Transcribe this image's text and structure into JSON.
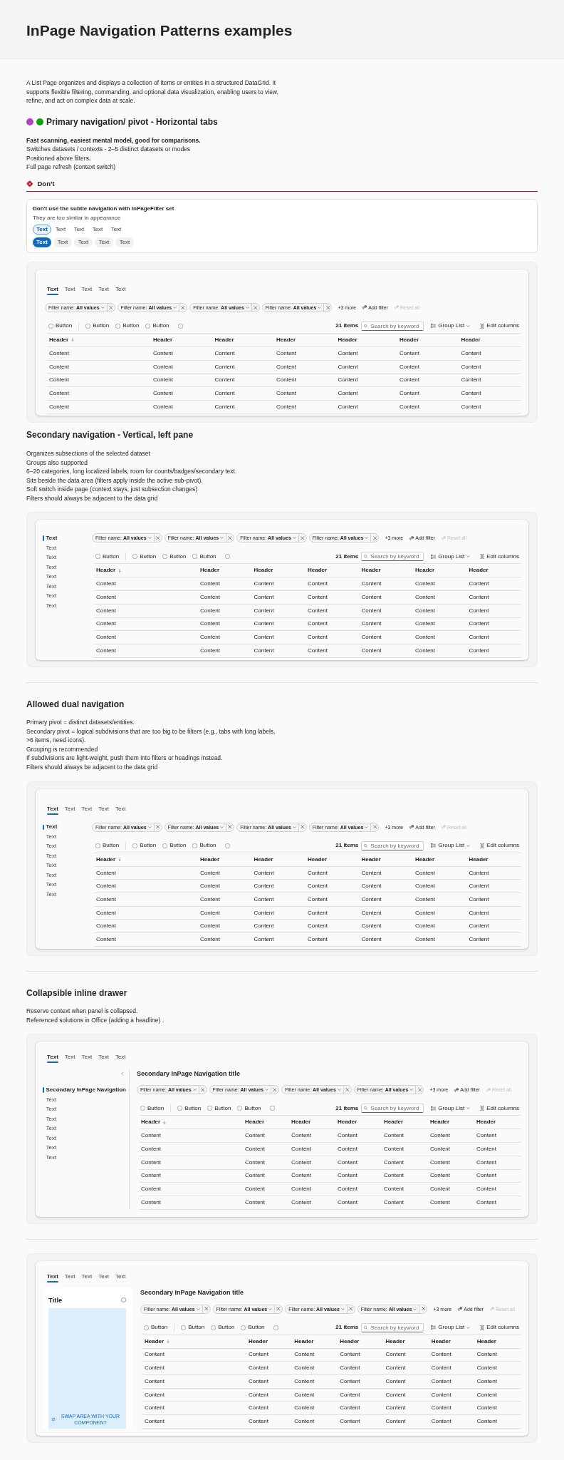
{
  "page_header": {
    "title": "InPage Navigation Patterns examples"
  },
  "intro": "A List Page organizes and displays a collection of items or entities in a structured DataGrid. It supports flexible filtering, commanding, and optional data visualization, enabling users to view, refine, and act on complex data at scale.",
  "sections": [
    {
      "divider_above": false,
      "title": "Primary navigation/ pivot - Horizontal tabs",
      "markers": [
        {
          "color": "#b146c2"
        },
        {
          "color": "#13a10e"
        }
      ],
      "notes": [
        {
          "text": "Fast scanning, easiest mental model, good for comparisons.",
          "bold": true
        },
        {
          "text": "Switches datasets / contexts - 2–5 distinct datasets or modes",
          "bold": false
        },
        {
          "text": "Positioned above filters**.**",
          "bold": false
        },
        {
          "text": "Full page refresh (context switch)",
          "bold": false
        }
      ],
      "guideline": {
        "kind": "dont",
        "label": "Don’t",
        "title": "Don't use the subtle navigation with InPageFilter set",
        "description": "They are too similar in appearance",
        "subtle_tabs": [
          {
            "label": "Text",
            "selected": true
          },
          {
            "label": "Text",
            "selected": false
          },
          {
            "label": "Text",
            "selected": false
          },
          {
            "label": "Text",
            "selected": false
          },
          {
            "label": "Text",
            "selected": false
          }
        ],
        "pill_tabs": [
          {
            "label": "Text",
            "selected": true
          },
          {
            "label": "Text",
            "selected": false
          },
          {
            "label": "Text",
            "selected": false
          },
          {
            "label": "Text",
            "selected": false
          },
          {
            "label": "Text",
            "selected": false
          }
        ]
      },
      "example": {
        "tabs": [
          {
            "label": "Text",
            "selected": true
          },
          {
            "label": "Text",
            "selected": false
          },
          {
            "label": "Text",
            "selected": false
          },
          {
            "label": "Text",
            "selected": false
          },
          {
            "label": "Text",
            "selected": false
          }
        ],
        "filters": [
          {
            "name": "Filter name:",
            "value": "All values"
          },
          {
            "name": "Filter name:",
            "value": "All values"
          },
          {
            "name": "Filter name:",
            "value": "All values"
          },
          {
            "name": "Filter name:",
            "value": "All values"
          }
        ],
        "more_filters": "+3 more",
        "add_filter": "Add filter",
        "reset": {
          "label": "Reset all",
          "disabled": true
        },
        "actions": [
          {
            "kind": "radio",
            "label": "Button",
            "checked": false
          },
          {
            "kind": "radio",
            "label": "Button",
            "checked": false
          },
          {
            "kind": "radio",
            "label": "Button",
            "checked": false
          },
          {
            "kind": "radio",
            "label": "Button",
            "checked": false
          },
          {
            "kind": "radio_icon",
            "checked": false
          }
        ],
        "item_count": "21 items",
        "search": {
          "placeholder": "Search by keyword"
        },
        "group_by": "Group List",
        "edit_columns": "Edit columns",
        "table": {
          "columns": [
            {
              "label": "Header",
              "sorted": true
            },
            {
              "label": "Header",
              "sorted": false
            },
            {
              "label": "Header",
              "sorted": false
            },
            {
              "label": "Header",
              "sorted": false
            },
            {
              "label": "Header",
              "sorted": false
            },
            {
              "label": "Header",
              "sorted": false
            },
            {
              "label": "Header",
              "sorted": false
            }
          ],
          "rows": [
            [
              "Content",
              "Content",
              "Content",
              "Content",
              "Content",
              "Content",
              "Content"
            ],
            [
              "Content",
              "Content",
              "Content",
              "Content",
              "Content",
              "Content",
              "Content"
            ],
            [
              "Content",
              "Content",
              "Content",
              "Content",
              "Content",
              "Content",
              "Content"
            ],
            [
              "Content",
              "Content",
              "Content",
              "Content",
              "Content",
              "Content",
              "Content"
            ],
            [
              "Content",
              "Content",
              "Content",
              "Content",
              "Content",
              "Content",
              "Content"
            ]
          ]
        }
      }
    },
    {
      "divider_above": false,
      "title": "Secondary navigation - Vertical, left pane",
      "notes": [
        {
          "text": "Organizes subsections of the selected dataset",
          "bold": false
        },
        {
          "text": "Groups also supported",
          "bold": false
        },
        {
          "text": "6–20 categories, long localized labels, room for counts/badges/secondary text.",
          "bold": false
        },
        {
          "text": "Sits beside the data area (filters apply inside the active sub-pivot).",
          "bold": false
        },
        {
          "text": "Soft switch inside page (context stays, just subsection changes)",
          "bold": false
        },
        {
          "text": "Filters should always be adjacent to the data grid",
          "bold": false
        }
      ],
      "example": {
        "side_nav": {
          "collapsible": false,
          "items": [
            {
              "label": "Text",
              "selected": true
            },
            {
              "label": "Text",
              "selected": false
            },
            {
              "label": "Text",
              "selected": false
            },
            {
              "label": "Text",
              "selected": false
            },
            {
              "label": "Text",
              "selected": false
            },
            {
              "label": "Text",
              "selected": false
            },
            {
              "label": "Text",
              "selected": false
            },
            {
              "label": "Text",
              "selected": false
            }
          ]
        },
        "filters": [
          {
            "name": "Filter name:",
            "value": "All values"
          },
          {
            "name": "Filter name:",
            "value": "All values"
          },
          {
            "name": "Filter name:",
            "value": "All values"
          },
          {
            "name": "Filter name:",
            "value": "All values"
          }
        ],
        "more_filters": "+3 more",
        "add_filter": "Add filter",
        "reset": {
          "label": "Reset all",
          "disabled": true
        },
        "actions": [
          {
            "kind": "radio",
            "label": "Button",
            "checked": false
          },
          {
            "kind": "radio",
            "label": "Button",
            "checked": false
          },
          {
            "kind": "radio",
            "label": "Button",
            "checked": false
          },
          {
            "kind": "radio",
            "label": "Button",
            "checked": false
          },
          {
            "kind": "radio_icon",
            "checked": false
          }
        ],
        "item_count": "21 items",
        "search": {
          "placeholder": "Search by keyword"
        },
        "group_by": "Group List",
        "edit_columns": "Edit columns",
        "table": {
          "columns": [
            {
              "label": "Header",
              "sorted": true
            },
            {
              "label": "Header",
              "sorted": false
            },
            {
              "label": "Header",
              "sorted": false
            },
            {
              "label": "Header",
              "sorted": false
            },
            {
              "label": "Header",
              "sorted": false
            },
            {
              "label": "Header",
              "sorted": false
            },
            {
              "label": "Header",
              "sorted": false
            }
          ],
          "rows": [
            [
              "Content",
              "Content",
              "Content",
              "Content",
              "Content",
              "Content",
              "Content"
            ],
            [
              "Content",
              "Content",
              "Content",
              "Content",
              "Content",
              "Content",
              "Content"
            ],
            [
              "Content",
              "Content",
              "Content",
              "Content",
              "Content",
              "Content",
              "Content"
            ],
            [
              "Content",
              "Content",
              "Content",
              "Content",
              "Content",
              "Content",
              "Content"
            ],
            [
              "Content",
              "Content",
              "Content",
              "Content",
              "Content",
              "Content",
              "Content"
            ],
            [
              "Content",
              "Content",
              "Content",
              "Content",
              "Content",
              "Content",
              "Content"
            ]
          ]
        }
      }
    },
    {
      "divider_above": true,
      "title": "Allowed dual navigation",
      "notes": [
        {
          "text": "Primary pivot = distinct datasets/entities.",
          "bold": false
        },
        {
          "text": "Secondary pivot = logical subdivisions that are too big to be filters (e.g., tabs with long labels, >6 items, need icons).",
          "bold": false
        },
        {
          "text": "Grouping is recommended",
          "bold": false
        },
        {
          "text": "If subdivisions are light-weight, push them into filters or headings instead.",
          "bold": false
        },
        {
          "text": "Filters should always be adjacent to the data grid",
          "bold": false
        }
      ],
      "example": {
        "tabs": [
          {
            "label": "Text",
            "selected": true
          },
          {
            "label": "Text",
            "selected": false
          },
          {
            "label": "Text",
            "selected": false
          },
          {
            "label": "Text",
            "selected": false
          },
          {
            "label": "Text",
            "selected": false
          }
        ],
        "side_nav": {
          "collapsible": false,
          "items": [
            {
              "label": "Text",
              "selected": true
            },
            {
              "label": "Text",
              "selected": false
            },
            {
              "label": "Text",
              "selected": false
            },
            {
              "label": "Text",
              "selected": false
            },
            {
              "label": "Text",
              "selected": false
            },
            {
              "label": "Text",
              "selected": false
            },
            {
              "label": "Text",
              "selected": false
            },
            {
              "label": "Text",
              "selected": false
            }
          ]
        },
        "filters": [
          {
            "name": "Filter name:",
            "value": "All values"
          },
          {
            "name": "Filter name:",
            "value": "All values"
          },
          {
            "name": "Filter name:",
            "value": "All values"
          },
          {
            "name": "Filter name:",
            "value": "All values"
          }
        ],
        "more_filters": "+3 more",
        "add_filter": "Add filter",
        "reset": {
          "label": "Reset all",
          "disabled": true
        },
        "actions": [
          {
            "kind": "radio",
            "label": "Button",
            "checked": false
          },
          {
            "kind": "radio",
            "label": "Button",
            "checked": false
          },
          {
            "kind": "radio",
            "label": "Button",
            "checked": false
          },
          {
            "kind": "radio",
            "label": "Button",
            "checked": false
          },
          {
            "kind": "radio_icon",
            "checked": false
          }
        ],
        "item_count": "21 items",
        "search": {
          "placeholder": "Search by keyword"
        },
        "group_by": "Group List",
        "edit_columns": "Edit columns",
        "table": {
          "columns": [
            {
              "label": "Header",
              "sorted": true
            },
            {
              "label": "Header",
              "sorted": false
            },
            {
              "label": "Header",
              "sorted": false
            },
            {
              "label": "Header",
              "sorted": false
            },
            {
              "label": "Header",
              "sorted": false
            },
            {
              "label": "Header",
              "sorted": false
            },
            {
              "label": "Header",
              "sorted": false
            }
          ],
          "rows": [
            [
              "Content",
              "Content",
              "Content",
              "Content",
              "Content",
              "Content",
              "Content"
            ],
            [
              "Content",
              "Content",
              "Content",
              "Content",
              "Content",
              "Content",
              "Content"
            ],
            [
              "Content",
              "Content",
              "Content",
              "Content",
              "Content",
              "Content",
              "Content"
            ],
            [
              "Content",
              "Content",
              "Content",
              "Content",
              "Content",
              "Content",
              "Content"
            ],
            [
              "Content",
              "Content",
              "Content",
              "Content",
              "Content",
              "Content",
              "Content"
            ],
            [
              "Content",
              "Content",
              "Content",
              "Content",
              "Content",
              "Content",
              "Content"
            ]
          ]
        }
      }
    },
    {
      "divider_above": true,
      "title": "Collapsible inline drawer",
      "notes": [
        {
          "text": "Reserve context when panel is collapsed.",
          "bold": false
        },
        {
          "text": "Referenced solutions in Office (adding a headline) .",
          "bold": false
        }
      ],
      "example": {
        "tabs": [
          {
            "label": "Text",
            "selected": true
          },
          {
            "label": "Text",
            "selected": false
          },
          {
            "label": "Text",
            "selected": false
          },
          {
            "label": "Text",
            "selected": false
          },
          {
            "label": "Text",
            "selected": false
          }
        ],
        "side_nav": {
          "collapsible": true,
          "items": [
            {
              "label": "Secondary InPage Navigation",
              "selected": true
            },
            {
              "label": "Text",
              "selected": false
            },
            {
              "label": "Text",
              "selected": false
            },
            {
              "label": "Text",
              "selected": false
            },
            {
              "label": "Text",
              "selected": false
            },
            {
              "label": "Text",
              "selected": false
            },
            {
              "label": "Text",
              "selected": false
            },
            {
              "label": "Text",
              "selected": false
            }
          ]
        },
        "title": "Secondary InPage Navigation title",
        "filters": [
          {
            "name": "Filter name:",
            "value": "All values"
          },
          {
            "name": "Filter name:",
            "value": "All values"
          },
          {
            "name": "Filter name:",
            "value": "All values"
          },
          {
            "name": "Filter name:",
            "value": "All values"
          }
        ],
        "more_filters": "+3 more",
        "add_filter": "Add filter",
        "reset": {
          "label": "Reset all",
          "disabled": true
        },
        "actions": [
          {
            "kind": "radio",
            "label": "Button",
            "checked": false
          },
          {
            "kind": "radio",
            "label": "Button",
            "checked": false
          },
          {
            "kind": "radio",
            "label": "Button",
            "checked": false
          },
          {
            "kind": "radio",
            "label": "Button",
            "checked": false
          },
          {
            "kind": "radio_icon",
            "checked": false
          }
        ],
        "item_count": "21 items",
        "search": {
          "placeholder": "Search by keyword"
        },
        "group_by": "Group List",
        "edit_columns": "Edit columns",
        "table": {
          "columns": [
            {
              "label": "Header",
              "sorted": true
            },
            {
              "label": "Header",
              "sorted": false
            },
            {
              "label": "Header",
              "sorted": false
            },
            {
              "label": "Header",
              "sorted": false
            },
            {
              "label": "Header",
              "sorted": false
            },
            {
              "label": "Header",
              "sorted": false
            },
            {
              "label": "Header",
              "sorted": false
            }
          ],
          "rows": [
            [
              "Content",
              "Content",
              "Content",
              "Content",
              "Content",
              "Content",
              "Content"
            ],
            [
              "Content",
              "Content",
              "Content",
              "Content",
              "Content",
              "Content",
              "Content"
            ],
            [
              "Content",
              "Content",
              "Content",
              "Content",
              "Content",
              "Content",
              "Content"
            ],
            [
              "Content",
              "Content",
              "Content",
              "Content",
              "Content",
              "Content",
              "Content"
            ],
            [
              "Content",
              "Content",
              "Content",
              "Content",
              "Content",
              "Content",
              "Content"
            ],
            [
              "Content",
              "Content",
              "Content",
              "Content",
              "Content",
              "Content",
              "Content"
            ]
          ]
        }
      }
    },
    {
      "divider_above": true,
      "example": {
        "tabs": [
          {
            "label": "Text",
            "selected": true
          },
          {
            "label": "Text",
            "selected": false
          },
          {
            "label": "Text",
            "selected": false
          },
          {
            "label": "Text",
            "selected": false
          },
          {
            "label": "Text",
            "selected": false
          }
        ],
        "panel": {
          "title": "Title",
          "placeholder": "SWAP AREA WITH YOUR COMPONENT"
        },
        "title": "Secondary InPage Navigation title",
        "filters": [
          {
            "name": "Filter name:",
            "value": "All values"
          },
          {
            "name": "Filter name:",
            "value": "All values"
          },
          {
            "name": "Filter name:",
            "value": "All values"
          },
          {
            "name": "Filter name:",
            "value": "All values"
          }
        ],
        "more_filters": "+3 more",
        "add_filter": "Add filter",
        "reset": {
          "label": "Reset all",
          "disabled": true
        },
        "actions": [
          {
            "kind": "radio",
            "label": "Button",
            "checked": false
          },
          {
            "kind": "radio",
            "label": "Button",
            "checked": false
          },
          {
            "kind": "radio",
            "label": "Button",
            "checked": false
          },
          {
            "kind": "radio",
            "label": "Button",
            "checked": false
          },
          {
            "kind": "radio_icon",
            "checked": false
          }
        ],
        "item_count": "21 items",
        "search": {
          "placeholder": "Search by keyword"
        },
        "group_by": "Group List",
        "edit_columns": "Edit columns",
        "table": {
          "columns": [
            {
              "label": "Header",
              "sorted": true
            },
            {
              "label": "Header",
              "sorted": false
            },
            {
              "label": "Header",
              "sorted": false
            },
            {
              "label": "Header",
              "sorted": false
            },
            {
              "label": "Header",
              "sorted": false
            },
            {
              "label": "Header",
              "sorted": false
            },
            {
              "label": "Header",
              "sorted": false
            }
          ],
          "rows": [
            [
              "Content",
              "Content",
              "Content",
              "Content",
              "Content",
              "Content",
              "Content"
            ],
            [
              "Content",
              "Content",
              "Content",
              "Content",
              "Content",
              "Content",
              "Content"
            ],
            [
              "Content",
              "Content",
              "Content",
              "Content",
              "Content",
              "Content",
              "Content"
            ],
            [
              "Content",
              "Content",
              "Content",
              "Content",
              "Content",
              "Content",
              "Content"
            ],
            [
              "Content",
              "Content",
              "Content",
              "Content",
              "Content",
              "Content",
              "Content"
            ],
            [
              "Content",
              "Content",
              "Content",
              "Content",
              "Content",
              "Content",
              "Content"
            ]
          ]
        }
      }
    }
  ]
}
